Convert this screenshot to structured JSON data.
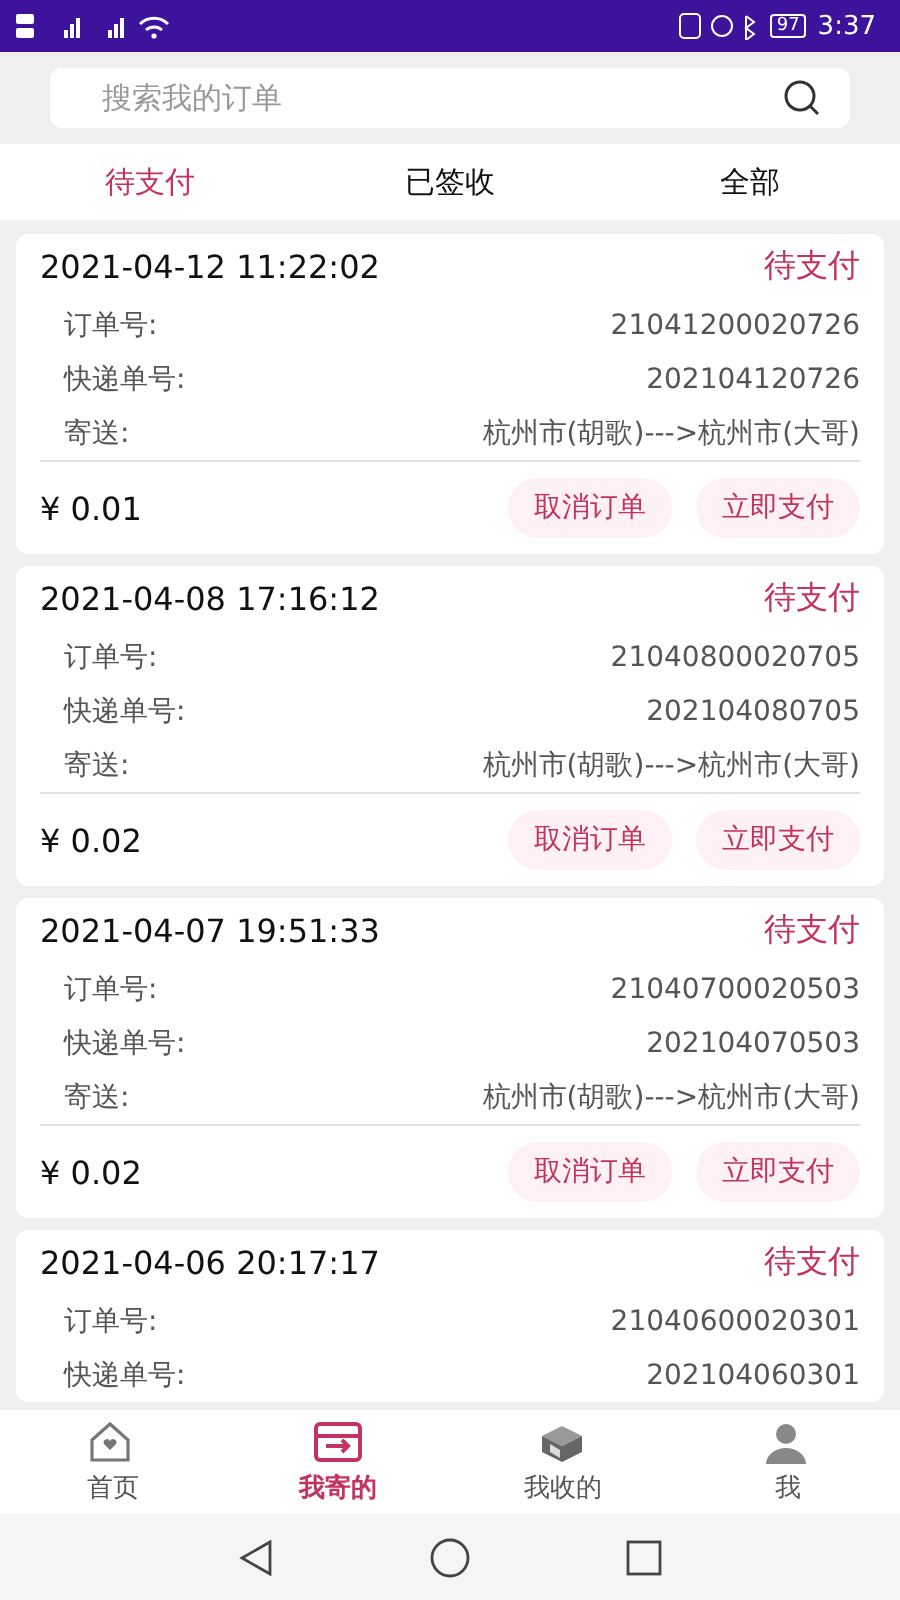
{
  "status_bar": {
    "time": "3:37",
    "battery": "97"
  },
  "search": {
    "placeholder": "搜索我的订单"
  },
  "tabs": [
    {
      "label": "待支付",
      "selected": true
    },
    {
      "label": "已签收",
      "selected": false
    },
    {
      "label": "全部",
      "selected": false
    }
  ],
  "orders": [
    {
      "time": "2021-04-12 11:22:02",
      "status": "待支付",
      "fields": [
        {
          "label": "订单号:",
          "value": "21041200020726"
        },
        {
          "label": "快递单号:",
          "value": "202104120726"
        },
        {
          "label": "寄送:",
          "value": "杭州市(胡歌)--->杭州市(大哥)"
        }
      ],
      "price": "¥ 0.01",
      "buttons": [
        "取消订单",
        "立即支付"
      ]
    },
    {
      "time": "2021-04-08 17:16:12",
      "status": "待支付",
      "fields": [
        {
          "label": "订单号:",
          "value": "21040800020705"
        },
        {
          "label": "快递单号:",
          "value": "202104080705"
        },
        {
          "label": "寄送:",
          "value": "杭州市(胡歌)--->杭州市(大哥)"
        }
      ],
      "price": "¥ 0.02",
      "buttons": [
        "取消订单",
        "立即支付"
      ]
    },
    {
      "time": "2021-04-07 19:51:33",
      "status": "待支付",
      "fields": [
        {
          "label": "订单号:",
          "value": "21040700020503"
        },
        {
          "label": "快递单号:",
          "value": "202104070503"
        },
        {
          "label": "寄送:",
          "value": "杭州市(胡歌)--->杭州市(大哥)"
        }
      ],
      "price": "¥ 0.02",
      "buttons": [
        "取消订单",
        "立即支付"
      ]
    },
    {
      "time": "2021-04-06 20:17:17",
      "status": "待支付",
      "fields": [
        {
          "label": "订单号:",
          "value": "21040600020301"
        },
        {
          "label": "快递单号:",
          "value": "202104060301"
        }
      ]
    }
  ],
  "bottom_nav": [
    {
      "label": "首页",
      "kind": "home",
      "selected": false
    },
    {
      "label": "我寄的",
      "kind": "send",
      "selected": true
    },
    {
      "label": "我收的",
      "kind": "receive",
      "selected": false
    },
    {
      "label": "我",
      "kind": "me",
      "selected": false
    }
  ]
}
